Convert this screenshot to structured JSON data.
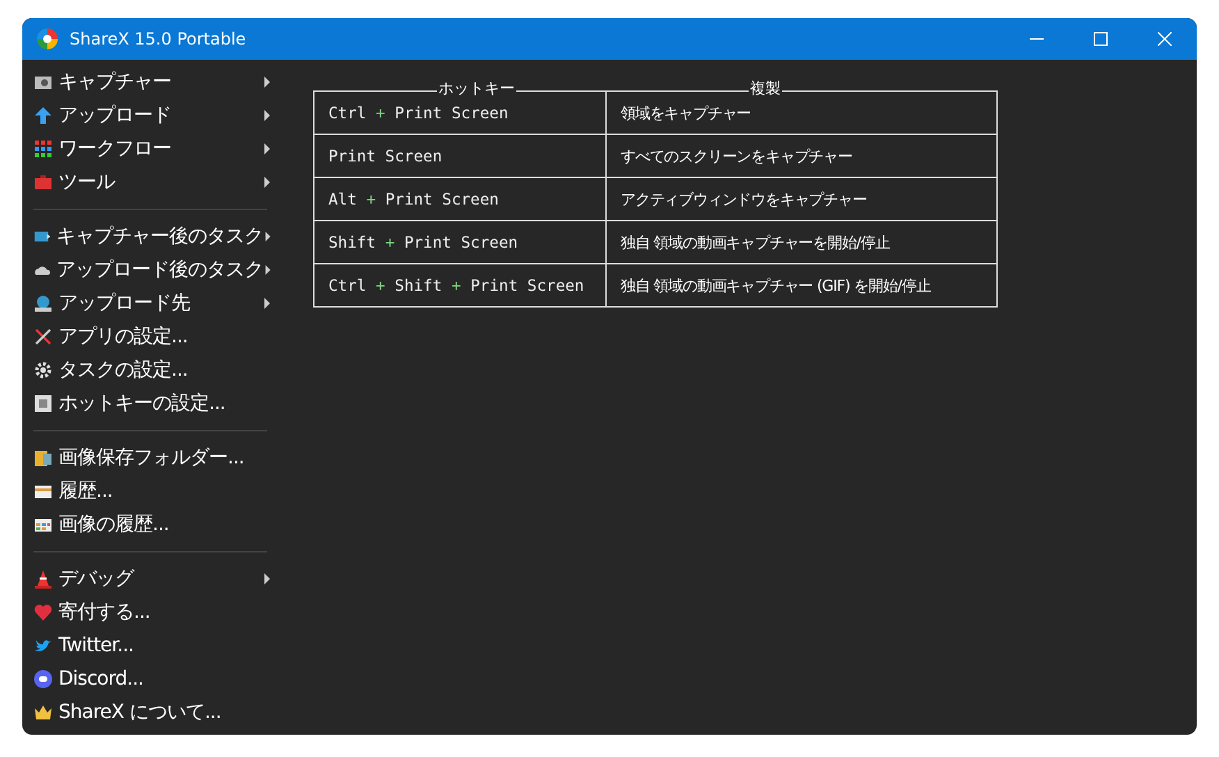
{
  "window": {
    "title": "ShareX 15.0 Portable"
  },
  "menu": [
    {
      "kind": "item",
      "label": "キャプチャー",
      "submenu": true
    },
    {
      "kind": "item",
      "label": "アップロード",
      "submenu": true
    },
    {
      "kind": "item",
      "label": "ワークフロー",
      "submenu": true
    },
    {
      "kind": "item",
      "label": "ツール",
      "submenu": true
    },
    {
      "kind": "separator"
    },
    {
      "kind": "item",
      "label": "キャプチャー後のタスク",
      "submenu": true
    },
    {
      "kind": "item",
      "label": "アップロード後のタスク",
      "submenu": true
    },
    {
      "kind": "item",
      "label": "アップロード先",
      "submenu": true
    },
    {
      "kind": "item",
      "label": "アプリの設定...",
      "submenu": false
    },
    {
      "kind": "item",
      "label": "タスクの設定...",
      "submenu": false
    },
    {
      "kind": "item",
      "label": "ホットキーの設定...",
      "submenu": false
    },
    {
      "kind": "separator"
    },
    {
      "kind": "item",
      "label": "画像保存フォルダー...",
      "submenu": false
    },
    {
      "kind": "item",
      "label": "履歴...",
      "submenu": false
    },
    {
      "kind": "item",
      "label": "画像の履歴...",
      "submenu": false
    },
    {
      "kind": "separator"
    },
    {
      "kind": "item",
      "label": "デバッグ",
      "submenu": true
    },
    {
      "kind": "item",
      "label": "寄付する...",
      "submenu": false
    },
    {
      "kind": "item",
      "label": "Twitter...",
      "submenu": false
    },
    {
      "kind": "item",
      "label": "Discord...",
      "submenu": false
    },
    {
      "kind": "item",
      "label": "ShareX について...",
      "submenu": false
    }
  ],
  "hotkeys": {
    "columns": [
      "ホットキー",
      "複製"
    ],
    "separator": "+",
    "rows": [
      {
        "keys": [
          "Ctrl",
          "Print Screen"
        ],
        "action": "領域をキャプチャー"
      },
      {
        "keys": [
          "Print Screen"
        ],
        "action": "すべてのスクリーンをキャプチャー"
      },
      {
        "keys": [
          "Alt",
          "Print Screen"
        ],
        "action": "アクティブウィンドウをキャプチャー"
      },
      {
        "keys": [
          "Shift",
          "Print Screen"
        ],
        "action": "独自 領域の動画キャプチャーを開始/停止"
      },
      {
        "keys": [
          "Ctrl",
          "Shift",
          "Print Screen"
        ],
        "action": "独自 領域の動画キャプチャー (GIF) を開始/停止"
      }
    ]
  }
}
